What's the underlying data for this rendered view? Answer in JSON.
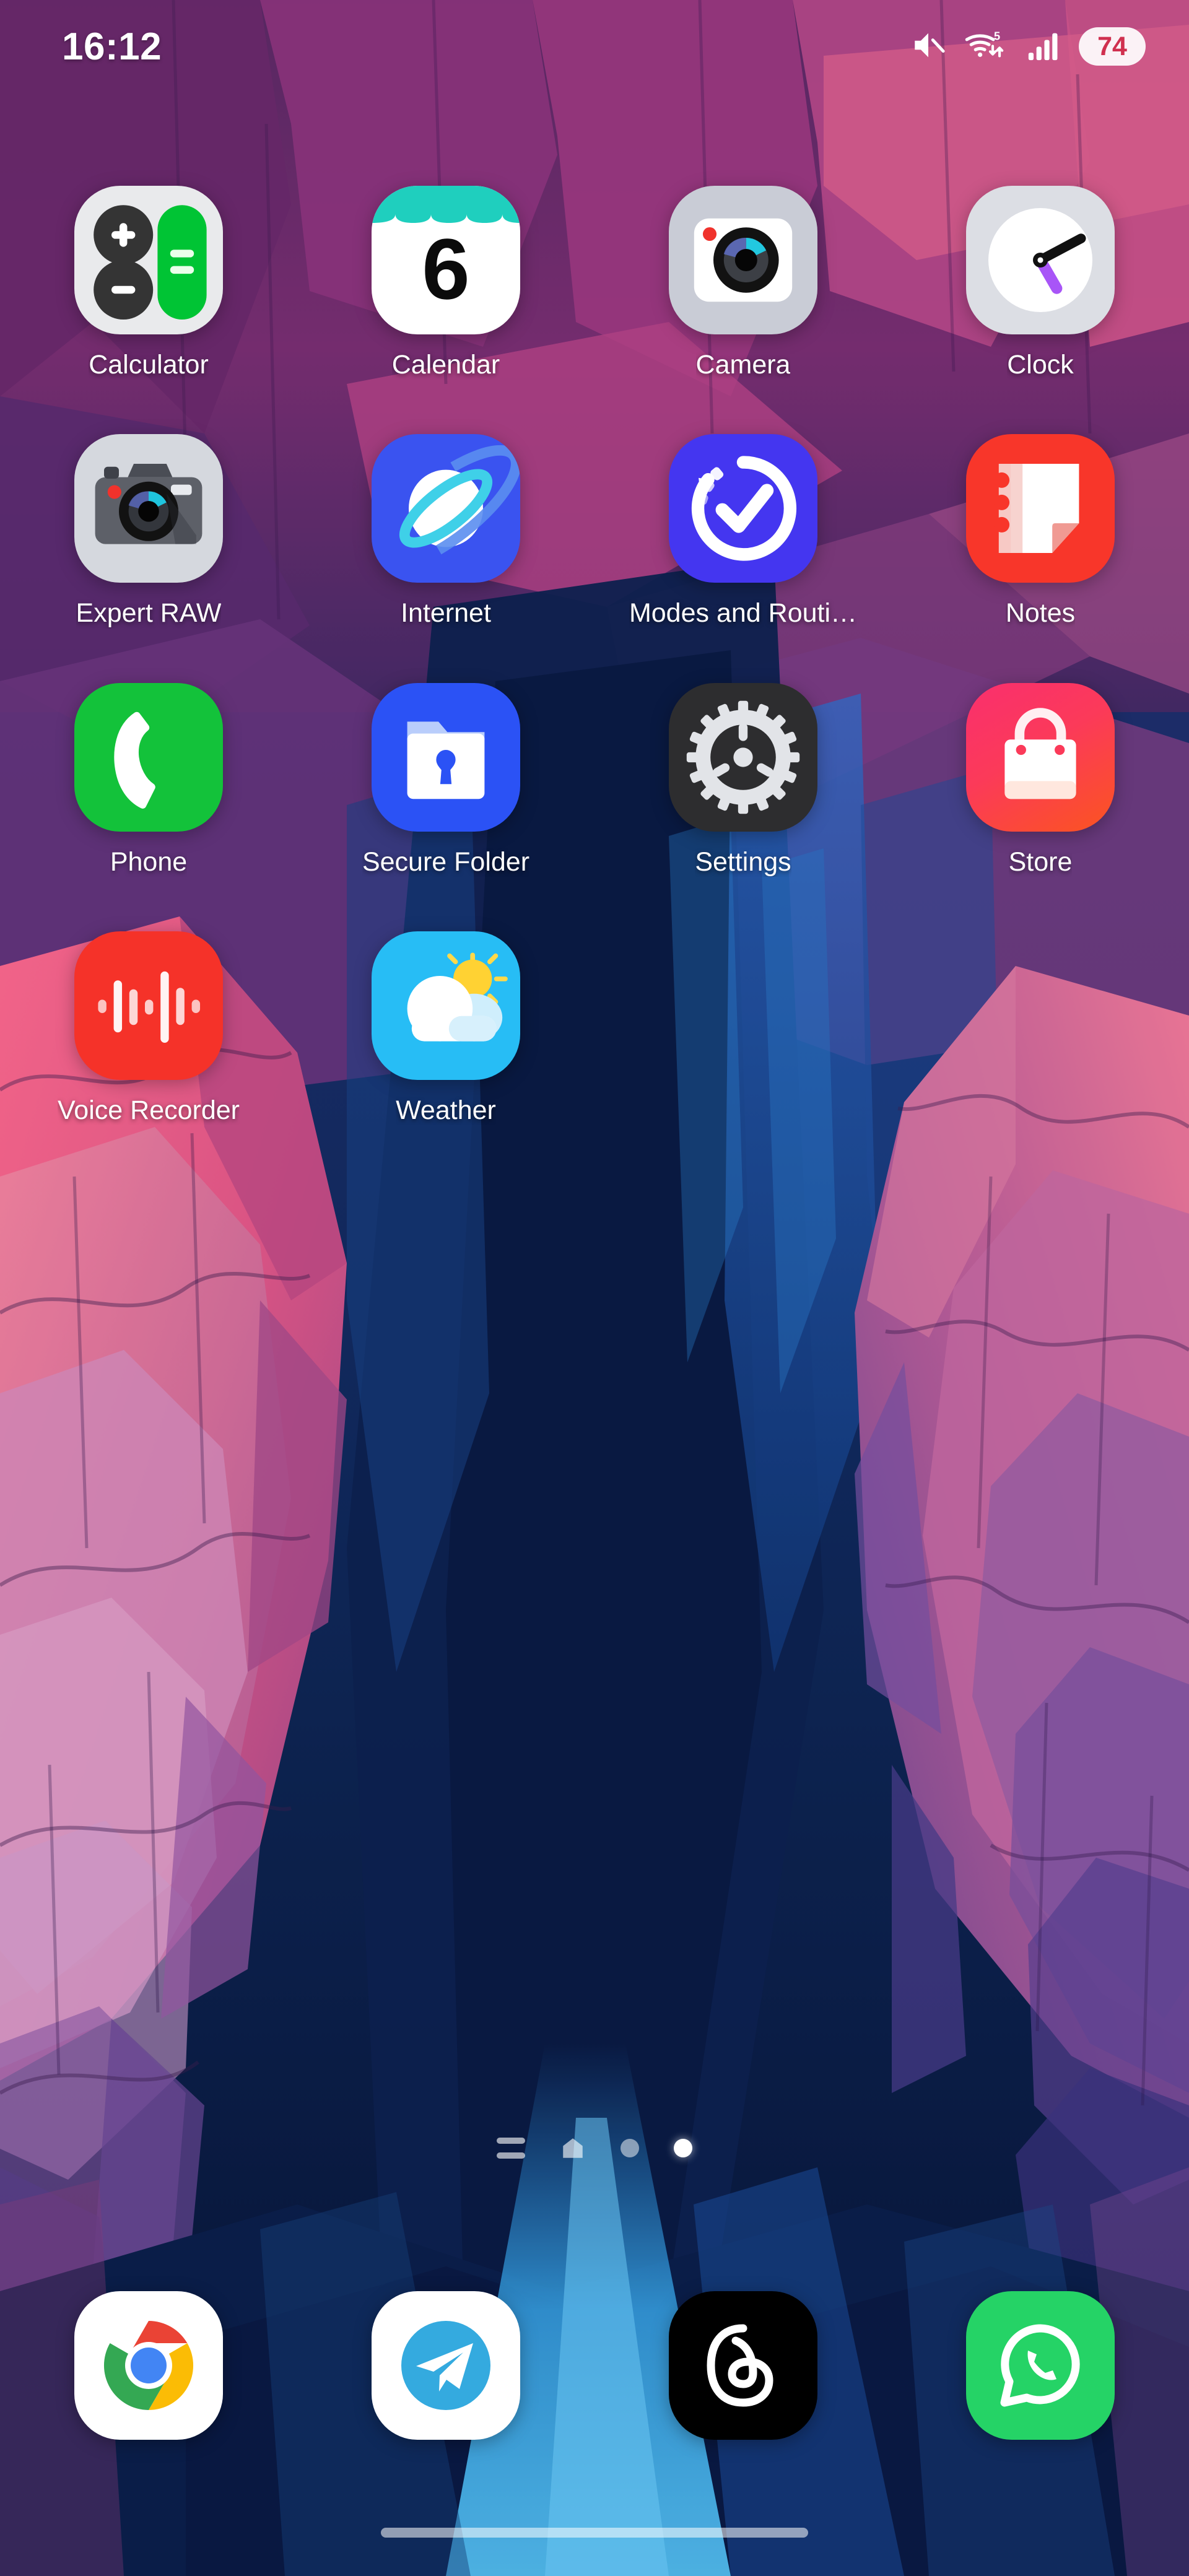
{
  "status_bar": {
    "time": "16:12",
    "battery_percent": "74",
    "icons": [
      "mute-icon",
      "wifi-icon",
      "signal-icon",
      "battery-icon"
    ],
    "wifi_generation": "5",
    "battery_pill_bg": "#ffffff",
    "battery_text_color": "#d0304f"
  },
  "apps": [
    {
      "label": "Calculator",
      "icon": "calculator-icon",
      "accent": "#00c434"
    },
    {
      "label": "Calendar",
      "icon": "calendar-icon",
      "accent": "#1fcfbe"
    },
    {
      "label": "Camera",
      "icon": "camera-icon",
      "accent": "#c9ccd6"
    },
    {
      "label": "Clock",
      "icon": "clock-icon",
      "accent": "#a855f7"
    },
    {
      "label": "Expert RAW",
      "icon": "expert-raw-icon",
      "accent": "#d5d8de"
    },
    {
      "label": "Internet",
      "icon": "internet-icon",
      "accent": "#3a53f0"
    },
    {
      "label": "Modes and Routi…",
      "icon": "modes-routines-icon",
      "accent": "#4436f0"
    },
    {
      "label": "Notes",
      "icon": "notes-icon",
      "accent": "#f8362a"
    },
    {
      "label": "Phone",
      "icon": "phone-icon",
      "accent": "#13c23a"
    },
    {
      "label": "Secure Folder",
      "icon": "secure-folder-icon",
      "accent": "#2b52f5"
    },
    {
      "label": "Settings",
      "icon": "settings-icon",
      "accent": "#2d2d2f"
    },
    {
      "label": "Store",
      "icon": "store-icon",
      "accent": "#fa2f6e"
    },
    {
      "label": "Voice Recorder",
      "icon": "voice-recorder-icon",
      "accent": "#f53229"
    },
    {
      "label": "Weather",
      "icon": "weather-icon",
      "accent": "#27bdf5"
    }
  ],
  "page_indicator": {
    "items": [
      "app-list-icon",
      "home-icon",
      "page-dot",
      "page-dot-active"
    ],
    "current_page": 4,
    "total_pages": 4
  },
  "dock": [
    {
      "label": "Chrome",
      "icon": "chrome-icon",
      "accent": "#ffffff"
    },
    {
      "label": "Telegram",
      "icon": "telegram-icon",
      "accent": "#34aadf"
    },
    {
      "label": "Threads",
      "icon": "threads-icon",
      "accent": "#000000"
    },
    {
      "label": "WhatsApp",
      "icon": "whatsapp-icon",
      "accent": "#25d366"
    }
  ],
  "navigation_bar": {
    "type": "gesture-pill"
  },
  "wallpaper": {
    "theme": "canyon-illustration",
    "colors": [
      "#1b2352",
      "#4b2f6e",
      "#8e3a78",
      "#f0618c",
      "#f8879f",
      "#2a3f8c",
      "#0e2456",
      "#0a1a44"
    ]
  }
}
